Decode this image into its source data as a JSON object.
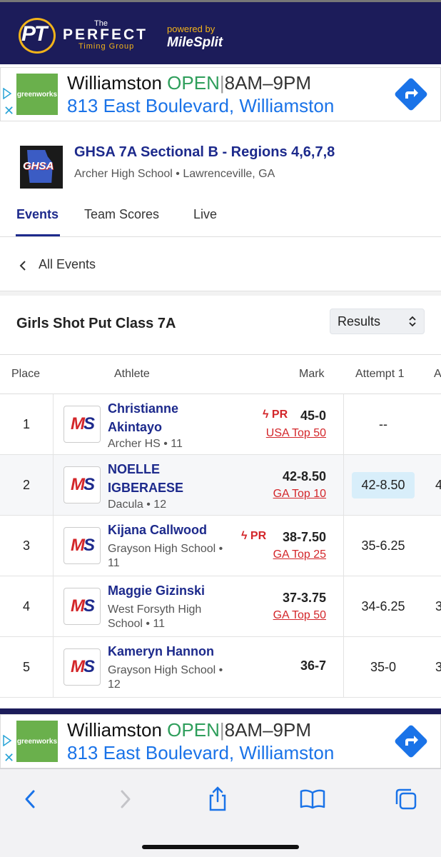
{
  "header": {
    "logo_letters": "PT",
    "logo_the": "The",
    "logo_perfect": "PERFECT",
    "logo_timing": "Timing Group",
    "powered_by": "powered by",
    "milesplit": "MileSplit"
  },
  "ad": {
    "brand": "greenworks",
    "business": "Williamston",
    "status": "OPEN",
    "separator": "|",
    "hours": "8AM–9PM",
    "address": "813 East Boulevard, Williamston",
    "info_icon": "i",
    "close_icon": "✕"
  },
  "meet": {
    "logo_text": "GHSA",
    "title": "GHSA 7A Sectional B - Regions 4,6,7,8",
    "subtitle": "Archer High School • Lawrenceville, GA"
  },
  "tabs": [
    {
      "label": "Events",
      "active": true
    },
    {
      "label": "Team Scores",
      "active": false
    },
    {
      "label": "Live",
      "active": false
    }
  ],
  "nav": {
    "back_chevron": "‹",
    "all_events": "All Events"
  },
  "event": {
    "title": "Girls Shot Put Class 7A",
    "view_select": "Results"
  },
  "table": {
    "headers": {
      "place": "Place",
      "athlete": "Athlete",
      "mark": "Mark",
      "attempt1": "Attempt 1",
      "attempt2": "A"
    },
    "rows": [
      {
        "place": "1",
        "name": "Christianne Akintayo",
        "team": "Archer HS • 11",
        "pr": "PR",
        "mark": "45-0",
        "rank": "USA Top 50",
        "attempt1": "--",
        "attempt2": "",
        "highlight": false
      },
      {
        "place": "2",
        "name": "NOELLE IGBERAESE",
        "team": "Dacula • 12",
        "pr": "",
        "mark": "42-8.50",
        "rank": "GA Top 10",
        "attempt1": "42-8.50",
        "attempt2": "4",
        "highlight": true
      },
      {
        "place": "3",
        "name": "Kijana Callwood",
        "team": "Grayson High School • 11",
        "pr": "PR",
        "mark": "38-7.50",
        "rank": "GA Top 25",
        "attempt1": "35-6.25",
        "attempt2": "",
        "highlight": false
      },
      {
        "place": "4",
        "name": "Maggie Gizinski",
        "team": "West Forsyth High School • 11",
        "pr": "",
        "mark": "37-3.75",
        "rank": "GA Top 50",
        "attempt1": "34-6.25",
        "attempt2": "3",
        "highlight": false
      },
      {
        "place": "5",
        "name": "Kameryn Hannon",
        "team": "Grayson High School • 12",
        "pr": "",
        "mark": "36-7",
        "rank": "",
        "attempt1": "35-0",
        "attempt2": "3",
        "highlight": false
      }
    ],
    "ms_logo_m": "M",
    "ms_logo_s": "S",
    "pr_bolt": "ϟ"
  },
  "colors": {
    "navy": "#1c1c5a",
    "brand_blue": "#1d2a8c",
    "red": "#d3262a",
    "gold": "#f2b31a",
    "ios_blue": "#1a73e8"
  },
  "safari_icons": [
    "back-icon",
    "forward-icon",
    "share-icon",
    "bookmarks-icon",
    "tabs-icon"
  ]
}
